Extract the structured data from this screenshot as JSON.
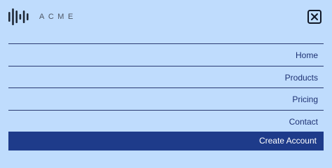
{
  "brand": {
    "name": "ACME",
    "logo_icon": "sound-wave-icon"
  },
  "header": {
    "close_icon": "close-icon"
  },
  "menu": {
    "items": [
      {
        "label": "Home"
      },
      {
        "label": "Products"
      },
      {
        "label": "Pricing"
      },
      {
        "label": "Contact"
      }
    ],
    "cta_label": "Create Account"
  },
  "colors": {
    "background": "#bfdcfd",
    "nav_text": "#1e3173",
    "divider": "#2b3b72",
    "cta_background": "#1e3b8a",
    "cta_text": "#ffffff"
  }
}
